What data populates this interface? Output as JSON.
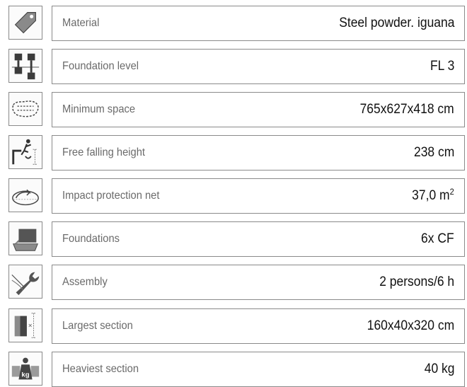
{
  "rows": [
    {
      "label": "Material",
      "value": "Steel powder. iguana",
      "icon": "price-tag-icon"
    },
    {
      "label": "Foundation level",
      "value": "FL 3",
      "icon": "foundation-level-icon"
    },
    {
      "label": "Minimum space",
      "value": "765x627x418 cm",
      "icon": "space-outline-icon"
    },
    {
      "label": "Free falling height",
      "value": "238 cm",
      "icon": "falling-person-icon"
    },
    {
      "label": "Impact protection net",
      "value": "37,0 m",
      "value_sup": "2",
      "icon": "impact-area-icon"
    },
    {
      "label": "Foundations",
      "value": "6x CF",
      "icon": "foundation-block-icon"
    },
    {
      "label": "Assembly",
      "value": "2 persons/6 h",
      "icon": "wrench-hand-icon"
    },
    {
      "label": "Largest section",
      "value": "160x40x320 cm",
      "icon": "section-size-icon"
    },
    {
      "label": "Heaviest section",
      "value": "40 kg",
      "icon": "weight-icon"
    }
  ],
  "colors": {
    "border": "#8a8a8a",
    "label": "#6a6a6a",
    "value": "#111111",
    "icon_fill": "#4a4a4a"
  }
}
